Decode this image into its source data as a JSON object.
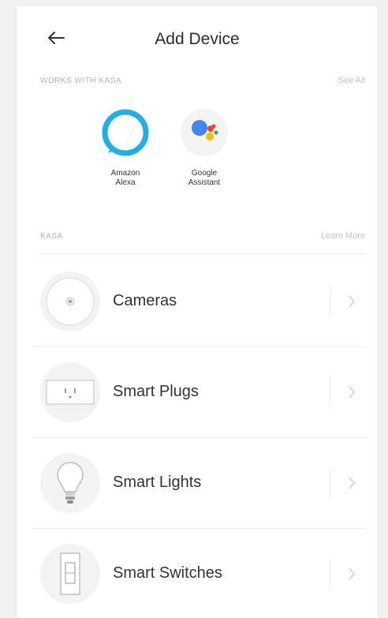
{
  "header": {
    "title": "Add Device"
  },
  "works_with": {
    "label": "WORKS WITH KASA",
    "link": "See All",
    "partners": [
      {
        "name": "Amazon\nAlexa",
        "icon": "alexa-ring-icon",
        "color": "#1fb1e6"
      },
      {
        "name": "Google\nAssistant",
        "icon": "google-assistant-icon",
        "colors": [
          "#4285f4",
          "#ea4335",
          "#fbbc05",
          "#34a853"
        ]
      }
    ]
  },
  "kasa": {
    "label": "KASA",
    "link": "Learn More",
    "items": [
      {
        "label": "Cameras",
        "icon": "camera-icon"
      },
      {
        "label": "Smart Plugs",
        "icon": "plug-icon"
      },
      {
        "label": "Smart Lights",
        "icon": "bulb-icon"
      },
      {
        "label": "Smart Switches",
        "icon": "switch-icon"
      }
    ]
  }
}
